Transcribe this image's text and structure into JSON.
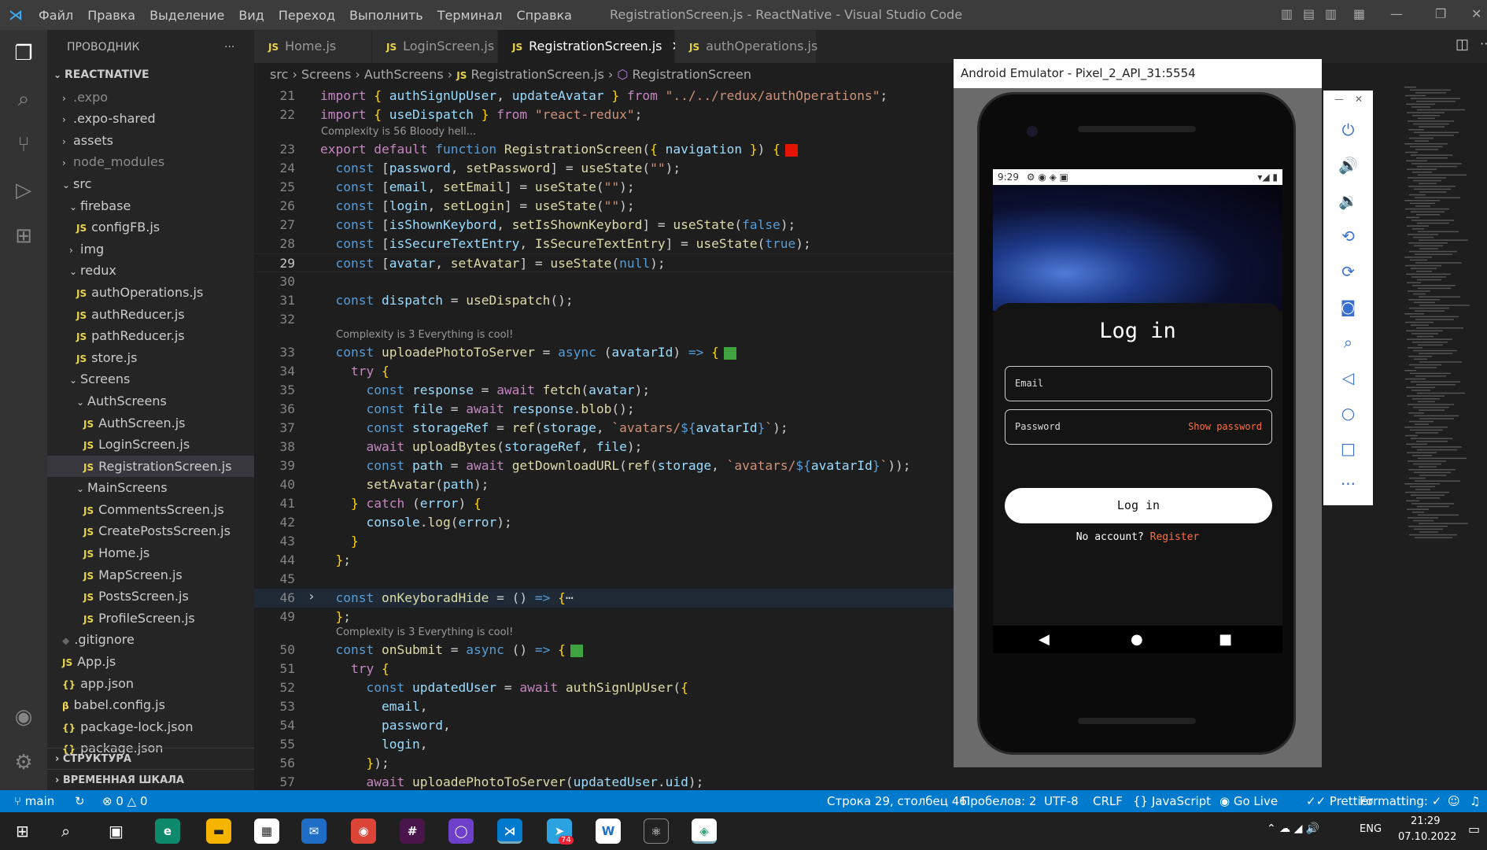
{
  "window": {
    "title": "RegistrationScreen.js - ReactNative - Visual Studio Code",
    "menu": [
      "Файл",
      "Правка",
      "Выделение",
      "Вид",
      "Переход",
      "Выполнить",
      "Терминал",
      "Справка"
    ]
  },
  "sidebar": {
    "header": "ПРОВОДНИК",
    "root": "REACTNATIVE",
    "items": [
      {
        "label": ".expo",
        "kind": "folder",
        "depth": 1,
        "collapsed": true,
        "dim": true
      },
      {
        "label": ".expo-shared",
        "kind": "folder",
        "depth": 1,
        "collapsed": true
      },
      {
        "label": "assets",
        "kind": "folder",
        "depth": 1,
        "collapsed": true
      },
      {
        "label": "node_modules",
        "kind": "folder",
        "depth": 1,
        "collapsed": true,
        "dim": true
      },
      {
        "label": "src",
        "kind": "folder",
        "depth": 1,
        "collapsed": false
      },
      {
        "label": "firebase",
        "kind": "folder",
        "depth": 2,
        "collapsed": false
      },
      {
        "label": "configFB.js",
        "kind": "js",
        "depth": 3
      },
      {
        "label": "img",
        "kind": "folder",
        "depth": 2,
        "collapsed": true
      },
      {
        "label": "redux",
        "kind": "folder",
        "depth": 2,
        "collapsed": false
      },
      {
        "label": "authOperations.js",
        "kind": "js",
        "depth": 3
      },
      {
        "label": "authReducer.js",
        "kind": "js",
        "depth": 3
      },
      {
        "label": "pathReducer.js",
        "kind": "js",
        "depth": 3
      },
      {
        "label": "store.js",
        "kind": "js",
        "depth": 3
      },
      {
        "label": "Screens",
        "kind": "folder",
        "depth": 2,
        "collapsed": false
      },
      {
        "label": "AuthScreens",
        "kind": "folder",
        "depth": 3,
        "collapsed": false
      },
      {
        "label": "AuthScreen.js",
        "kind": "js",
        "depth": 4
      },
      {
        "label": "LoginScreen.js",
        "kind": "js",
        "depth": 4
      },
      {
        "label": "RegistrationScreen.js",
        "kind": "js",
        "depth": 4,
        "selected": true
      },
      {
        "label": "MainScreens",
        "kind": "folder",
        "depth": 3,
        "collapsed": false
      },
      {
        "label": "CommentsScreen.js",
        "kind": "js",
        "depth": 4
      },
      {
        "label": "CreatePostsScreen.js",
        "kind": "js",
        "depth": 4
      },
      {
        "label": "Home.js",
        "kind": "js",
        "depth": 4
      },
      {
        "label": "MapScreen.js",
        "kind": "js",
        "depth": 4
      },
      {
        "label": "PostsScreen.js",
        "kind": "js",
        "depth": 4
      },
      {
        "label": "ProfileScreen.js",
        "kind": "js",
        "depth": 4
      },
      {
        "label": ".gitignore",
        "kind": "git",
        "depth": 1
      },
      {
        "label": "App.js",
        "kind": "js",
        "depth": 1
      },
      {
        "label": "app.json",
        "kind": "json",
        "depth": 1
      },
      {
        "label": "babel.config.js",
        "kind": "babel",
        "depth": 1
      },
      {
        "label": "package-lock.json",
        "kind": "json",
        "depth": 1
      },
      {
        "label": "package.json",
        "kind": "json",
        "depth": 1
      }
    ],
    "outline": "СТРУКТУРА",
    "timeline": "ВРЕМЕННАЯ ШКАЛА"
  },
  "tabs": [
    {
      "label": "Home.js"
    },
    {
      "label": "LoginScreen.js"
    },
    {
      "label": "RegistrationScreen.js",
      "active": true
    },
    {
      "label": "authOperations.js"
    }
  ],
  "breadcrumb": [
    "src",
    "Screens",
    "AuthScreens",
    "RegistrationScreen.js",
    "RegistrationScreen"
  ],
  "codelens": [
    "Complexity is 56 Bloody hell...",
    "Complexity is 3 Everything is cool!",
    "Complexity is 3 Everything is cool!"
  ],
  "statusbar": {
    "branch": "main",
    "problems": "0",
    "warnings": "0",
    "position": "Строка 29, столбец 46",
    "spaces": "Пробелов: 2",
    "encoding": "UTF-8",
    "eol": "CRLF",
    "language": "JavaScript",
    "golive": "Go Live",
    "prettier": "Prettier",
    "formatting": "Formatting: ✓"
  },
  "emulator": {
    "title": "Android Emulator - Pixel_2_API_31:5554",
    "time": "9:29",
    "screen_title": "Log in",
    "email_placeholder": "Email",
    "password_placeholder": "Password",
    "show_password": "Show password",
    "login_button": "Log in",
    "no_account": "No account?",
    "register": "Register"
  },
  "taskbar": {
    "lang": "ENG",
    "time": "21:29",
    "date": "07.10.2022",
    "telegram_badge": "74"
  }
}
